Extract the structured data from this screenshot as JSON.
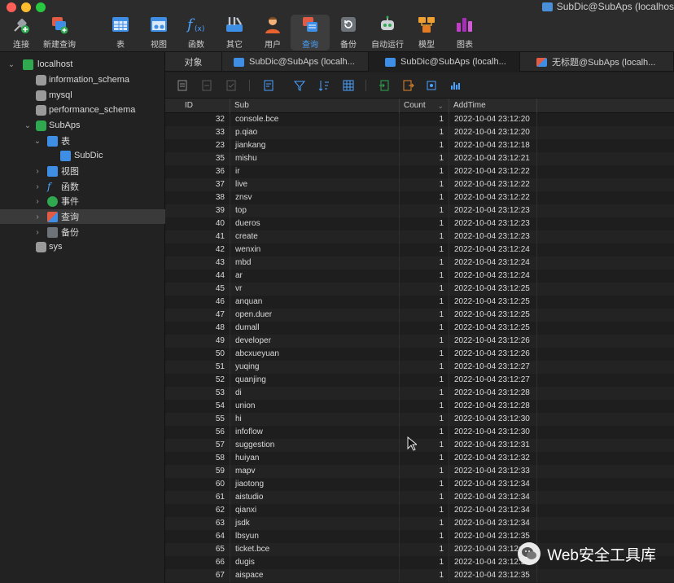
{
  "window": {
    "title": "SubDic@SubAps (localhos"
  },
  "toolbar": {
    "buttons": [
      {
        "label": "连接",
        "icon": "plug-icon"
      },
      {
        "label": "新建查询",
        "icon": "new-query-icon"
      },
      {
        "label": "表",
        "icon": "table-icon"
      },
      {
        "label": "视图",
        "icon": "view-icon"
      },
      {
        "label": "函数",
        "icon": "function-icon"
      },
      {
        "label": "其它",
        "icon": "tools-icon"
      },
      {
        "label": "用户",
        "icon": "user-icon"
      },
      {
        "label": "查询",
        "icon": "query-icon"
      },
      {
        "label": "备份",
        "icon": "backup-icon"
      },
      {
        "label": "自动运行",
        "icon": "robot-icon"
      },
      {
        "label": "模型",
        "icon": "model-icon"
      },
      {
        "label": "图表",
        "icon": "chart-icon"
      }
    ],
    "active": "查询"
  },
  "sidebar": {
    "connection": "localhost",
    "items": [
      {
        "label": "information_schema"
      },
      {
        "label": "mysql"
      },
      {
        "label": "performance_schema"
      },
      {
        "label": "SubAps"
      },
      {
        "label": "表"
      },
      {
        "label": "SubDic"
      },
      {
        "label": "视图"
      },
      {
        "label": "函数"
      },
      {
        "label": "事件"
      },
      {
        "label": "查询"
      },
      {
        "label": "备份"
      },
      {
        "label": "sys"
      }
    ]
  },
  "tabs": [
    {
      "label": "对象"
    },
    {
      "label": "SubDic@SubAps (localh..."
    },
    {
      "label": "SubDic@SubAps (localh..."
    },
    {
      "label": "无标题@SubAps (localh..."
    }
  ],
  "grid": {
    "columns": [
      "ID",
      "Sub",
      "Count",
      "AddTime"
    ],
    "rows": [
      [
        "32",
        "console.bce",
        "1",
        "2022-10-04 23:12:20"
      ],
      [
        "33",
        "p.qiao",
        "1",
        "2022-10-04 23:12:20"
      ],
      [
        "23",
        "jiankang",
        "1",
        "2022-10-04 23:12:18"
      ],
      [
        "35",
        "mishu",
        "1",
        "2022-10-04 23:12:21"
      ],
      [
        "36",
        "ir",
        "1",
        "2022-10-04 23:12:22"
      ],
      [
        "37",
        "live",
        "1",
        "2022-10-04 23:12:22"
      ],
      [
        "38",
        "znsv",
        "1",
        "2022-10-04 23:12:22"
      ],
      [
        "39",
        "top",
        "1",
        "2022-10-04 23:12:23"
      ],
      [
        "40",
        "dueros",
        "1",
        "2022-10-04 23:12:23"
      ],
      [
        "41",
        "create",
        "1",
        "2022-10-04 23:12:23"
      ],
      [
        "42",
        "wenxin",
        "1",
        "2022-10-04 23:12:24"
      ],
      [
        "43",
        "mbd",
        "1",
        "2022-10-04 23:12:24"
      ],
      [
        "44",
        "ar",
        "1",
        "2022-10-04 23:12:24"
      ],
      [
        "45",
        "vr",
        "1",
        "2022-10-04 23:12:25"
      ],
      [
        "46",
        "anquan",
        "1",
        "2022-10-04 23:12:25"
      ],
      [
        "47",
        "open.duer",
        "1",
        "2022-10-04 23:12:25"
      ],
      [
        "48",
        "dumall",
        "1",
        "2022-10-04 23:12:25"
      ],
      [
        "49",
        "developer",
        "1",
        "2022-10-04 23:12:26"
      ],
      [
        "50",
        "abcxueyuan",
        "1",
        "2022-10-04 23:12:26"
      ],
      [
        "51",
        "yuqing",
        "1",
        "2022-10-04 23:12:27"
      ],
      [
        "52",
        "quanjing",
        "1",
        "2022-10-04 23:12:27"
      ],
      [
        "53",
        "di",
        "1",
        "2022-10-04 23:12:28"
      ],
      [
        "54",
        "union",
        "1",
        "2022-10-04 23:12:28"
      ],
      [
        "55",
        "hi",
        "1",
        "2022-10-04 23:12:30"
      ],
      [
        "56",
        "infoflow",
        "1",
        "2022-10-04 23:12:30"
      ],
      [
        "57",
        "suggestion",
        "1",
        "2022-10-04 23:12:31"
      ],
      [
        "58",
        "huiyan",
        "1",
        "2022-10-04 23:12:32"
      ],
      [
        "59",
        "mapv",
        "1",
        "2022-10-04 23:12:33"
      ],
      [
        "60",
        "jiaotong",
        "1",
        "2022-10-04 23:12:34"
      ],
      [
        "61",
        "aistudio",
        "1",
        "2022-10-04 23:12:34"
      ],
      [
        "62",
        "qianxi",
        "1",
        "2022-10-04 23:12:34"
      ],
      [
        "63",
        "jsdk",
        "1",
        "2022-10-04 23:12:34"
      ],
      [
        "64",
        "lbsyun",
        "1",
        "2022-10-04 23:12:35"
      ],
      [
        "65",
        "ticket.bce",
        "1",
        "2022-10-04 23:12:35"
      ],
      [
        "66",
        "dugis",
        "1",
        "2022-10-04 23:12:35"
      ],
      [
        "67",
        "aispace",
        "1",
        "2022-10-04 23:12:35"
      ]
    ]
  },
  "watermark": {
    "text": "Web安全工具库"
  }
}
